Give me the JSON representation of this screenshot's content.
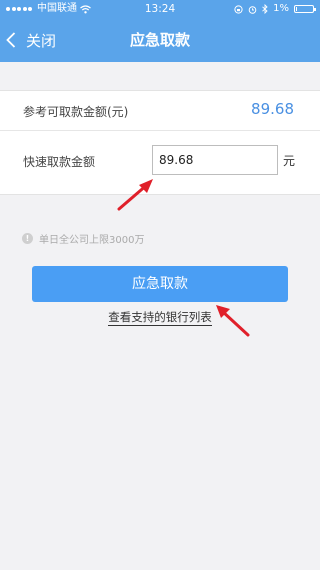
{
  "status_bar": {
    "carrier": "中国联通",
    "time": "13:24",
    "battery": "1%",
    "battery_level": 0.01,
    "icons": [
      "signal-icon",
      "wifi-icon",
      "lock-rotation-icon",
      "alarm-icon",
      "bluetooth-icon",
      "battery-icon"
    ]
  },
  "nav": {
    "back_label": "关闭",
    "title": "应急取款"
  },
  "form": {
    "reference_label": "参考可取款金额(元)",
    "reference_value": "89.68",
    "fast_label": "快速取款金额",
    "amount_value": "89.68",
    "unit": "元"
  },
  "notice": {
    "text": "单日全公司上限3000万",
    "icon": "info-icon"
  },
  "actions": {
    "primary_label": "应急取款",
    "bank_link": "查看支持的银行列表"
  },
  "colors": {
    "header": "#5aa4ea",
    "button": "#4a9ef4",
    "value_blue": "#4a90e2",
    "arrow_red": "#e0202a",
    "background": "#f2f2f4"
  }
}
